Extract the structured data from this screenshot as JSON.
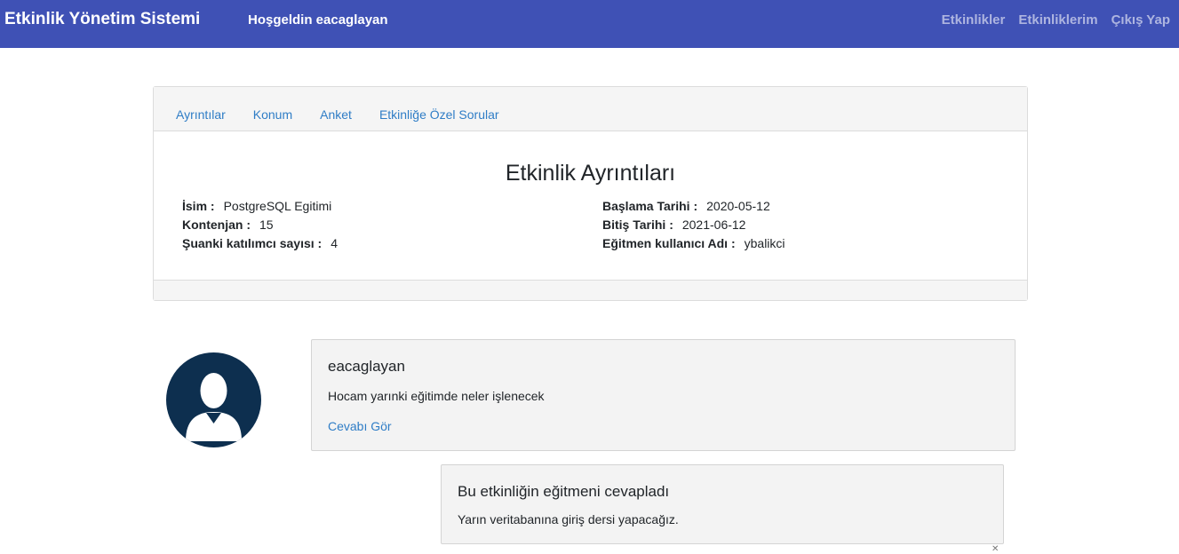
{
  "navbar": {
    "brand": "Etkinlik Yönetim Sistemi",
    "welcome": "Hoşgeldin eacaglayan",
    "links": [
      "Etkinlikler",
      "Etkinliklerim",
      "Çıkış Yap"
    ],
    "background": "#3f51b5"
  },
  "tabs": [
    "Ayrıntılar",
    "Konum",
    "Anket",
    "Etkinliğe Özel Sorular"
  ],
  "details": {
    "title": "Etkinlik Ayrıntıları",
    "name_label": "İsim :",
    "name_value": "PostgreSQL Egitimi",
    "capacity_label": "Kontenjan :",
    "capacity_value": "15",
    "participants_label": "Şuanki katılımcı sayısı :",
    "participants_value": "4",
    "start_label": "Başlama Tarihi :",
    "start_value": "2020-05-12",
    "end_label": "Bitiş Tarihi :",
    "end_value": "2021-06-12",
    "instructor_label": "Eğitmen kullanıcı Adı :",
    "instructor_value": "ybalikci"
  },
  "comment": {
    "avatar_icon": "user-avatar-icon",
    "user": "eacaglayan",
    "text": "Hocam yarınki eğitimde neler işlenecek",
    "link": "Cevabı Gör"
  },
  "reply": {
    "title": "Bu etkinliğin eğitmeni cevapladı",
    "text": "Yarın veritabanına giriş dersi yapacağız."
  }
}
